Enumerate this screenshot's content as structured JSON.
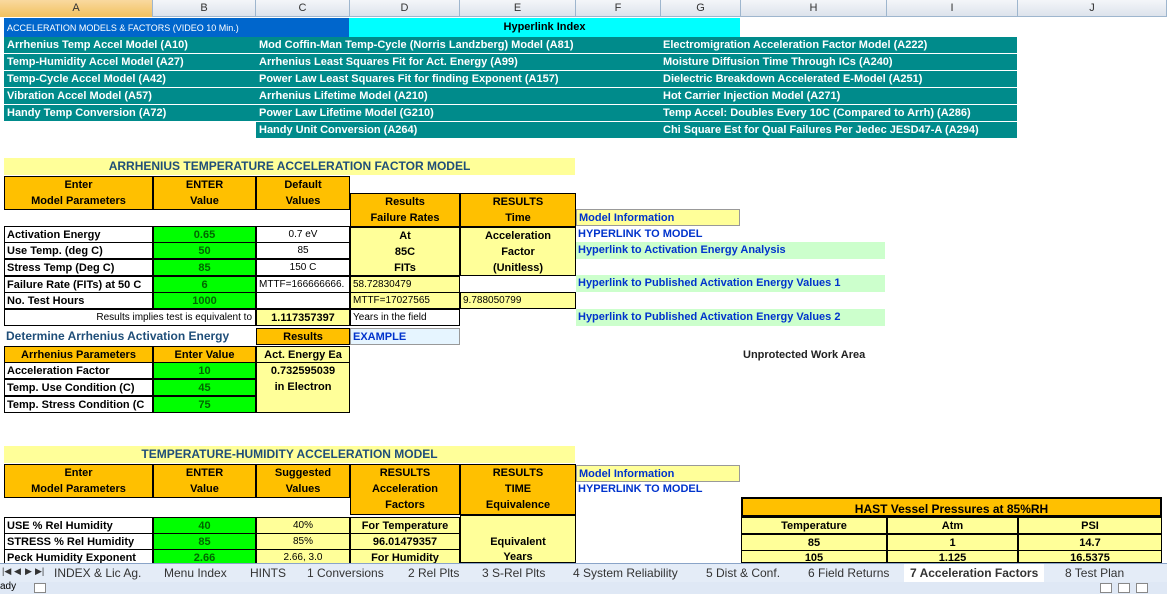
{
  "col_headers": [
    "A",
    "B",
    "C",
    "D",
    "E",
    "F",
    "G",
    "H",
    "I",
    "J"
  ],
  "selected_col": "A",
  "header": {
    "title": "ACCELERATION MODELS & FACTORS (VIDEO 10 Min.)",
    "hyperlink_index": "Hyperlink Index"
  },
  "links": {
    "a1": "Arrhenius Temp Accel Model (A10)",
    "a2": "Temp-Humidity Accel Model (A27)",
    "a3": "Temp-Cycle Accel Model (A42)",
    "a4": "Vibration Accel Model (A57)",
    "a5": "Handy Temp Conversion (A72)",
    "c1": "Mod Coffin-Man Temp-Cycle (Norris Landzberg) Model (A81)",
    "c2": "Arrhenius Least Squares Fit for Act. Energy (A99)",
    "c3": "Power Law Least Squares Fit for finding Exponent (A157)",
    "c4": "Arrhenius Lifetime Model (A210)",
    "c5": "Power Law Lifetime Model (G210)",
    "c6": "Handy Unit Conversion (A264)",
    "g1": "Electromigration Acceleration Factor Model (A222)",
    "g2": "Moisture Diffusion Time Through ICs (A240)",
    "g3": "Dielectric Breakdown Accelerated E-Model (A251)",
    "g4": "Hot Carrier Injection Model (A271)",
    "g5": "Temp Accel: Doubles Every 10C (Compared to Arrh)  (A286)",
    "g6": "Chi Square Est for Qual Failures Per Jedec JESD47-A (A294)"
  },
  "arrhenius": {
    "title": "ARRHENIUS TEMPERATURE ACCELERATION FACTOR MODEL",
    "h_enter1": "Enter",
    "h_enter2": "Model Parameters",
    "h_val1": "ENTER",
    "h_val2": "Value",
    "h_def1": "Default",
    "h_def2": "Values",
    "h_res1": "Results",
    "h_res2": "Failure Rates",
    "h_res3": "At",
    "h_res4": "85C",
    "h_res5": "FITs",
    "h_R1": "RESULTS",
    "h_R2": "Time",
    "h_R3": "Acceleration",
    "h_R4": "Factor",
    "h_R5": "(Unitless)",
    "rows": [
      {
        "label": "Activation Energy",
        "value": "0.65",
        "default": "0.7 eV"
      },
      {
        "label": "Use Temp. (deg C)",
        "value": "50",
        "default": "85"
      },
      {
        "label": "Stress Temp (Deg C)",
        "value": "85",
        "default": "150 C"
      },
      {
        "label": "Failure Rate (FITs) at 50 C",
        "value": "6",
        "default": "MTTF=166666666."
      },
      {
        "label": "No. Test Hours",
        "value": "1000",
        "default": ""
      }
    ],
    "fits": "58.72830479",
    "mttf": "MTTF=17027565",
    "accel": "9.788050799",
    "implies": "Results implies test is equivalent to",
    "years": "1.117357397",
    "years_lbl": "Years in the field",
    "model_info": "Model Information",
    "hyper_model": "HYPERLINK TO MODEL",
    "hyper_act": "Hyperlink to Activation Energy Analysis",
    "hyper_pub1": "Hyperlink to Published Activation Energy Values 1",
    "hyper_pub2": "Hyperlink to Published Activation Energy Values 2"
  },
  "determine": {
    "title": "Determine Arrhenius Activation Energy",
    "results": "Results",
    "example": "EXAMPLE",
    "h_param": "Arrhenius Parameters",
    "h_enter": "Enter Value",
    "h_act": "Act. Energy Ea",
    "rows": [
      {
        "label": "Acceleration Factor",
        "value": "10"
      },
      {
        "label": "Temp. Use Condition (C)",
        "value": "45"
      },
      {
        "label": "Temp. Stress Condition (C",
        "value": "75"
      }
    ],
    "ea": "0.732595039",
    "ea_unit": "in Electron"
  },
  "unprotected": "Unprotected Work Area",
  "humidity": {
    "title": "TEMPERATURE-HUMIDITY ACCELERATION MODEL",
    "h_enter1": "Enter",
    "h_enter2": "Model Parameters",
    "h_val1": "ENTER",
    "h_val2": "Value",
    "h_sug1": "Suggested",
    "h_sug2": "Values",
    "h_res1": "RESULTS",
    "h_res2": "Acceleration",
    "h_res3": "Factors",
    "h_R1": "RESULTS",
    "h_R2": "TIME",
    "h_R3": "Equivalence",
    "rows": [
      {
        "label": "USE % Rel Humidity",
        "value": "40",
        "sug": "40%"
      },
      {
        "label": "STRESS % Rel Humidity",
        "value": "85",
        "sug": "85%"
      },
      {
        "label": "Peck Humidity Exponent",
        "value": "2.66",
        "sug": "2.66, 3.0"
      }
    ],
    "for_temp": "For Temperature",
    "temp_val": "96.01479357",
    "for_hum": "For Humidity",
    "equiv": "Equivalent",
    "years": "Years",
    "model_info": "Model Information",
    "hyper_model": "HYPERLINK TO MODEL"
  },
  "hast": {
    "title": "HAST Vessel Pressures at 85%RH",
    "cols": [
      "Temperature",
      "Atm",
      "PSI"
    ],
    "rows": [
      [
        "85",
        "1",
        "14.7"
      ],
      [
        "105",
        "1.125",
        "16.5375"
      ]
    ]
  },
  "tabs": [
    "INDEX & Lic Ag.",
    "Menu Index",
    "HINTS",
    "1 Conversions",
    "2 Rel Plts",
    "3 S-Rel Plts",
    "4 System Reliability",
    "5 Dist & Conf.",
    "6 Field Returns",
    "7 Acceleration Factors",
    "8 Test Plan"
  ],
  "active_tab": "7 Acceleration Factors",
  "status": "ady"
}
